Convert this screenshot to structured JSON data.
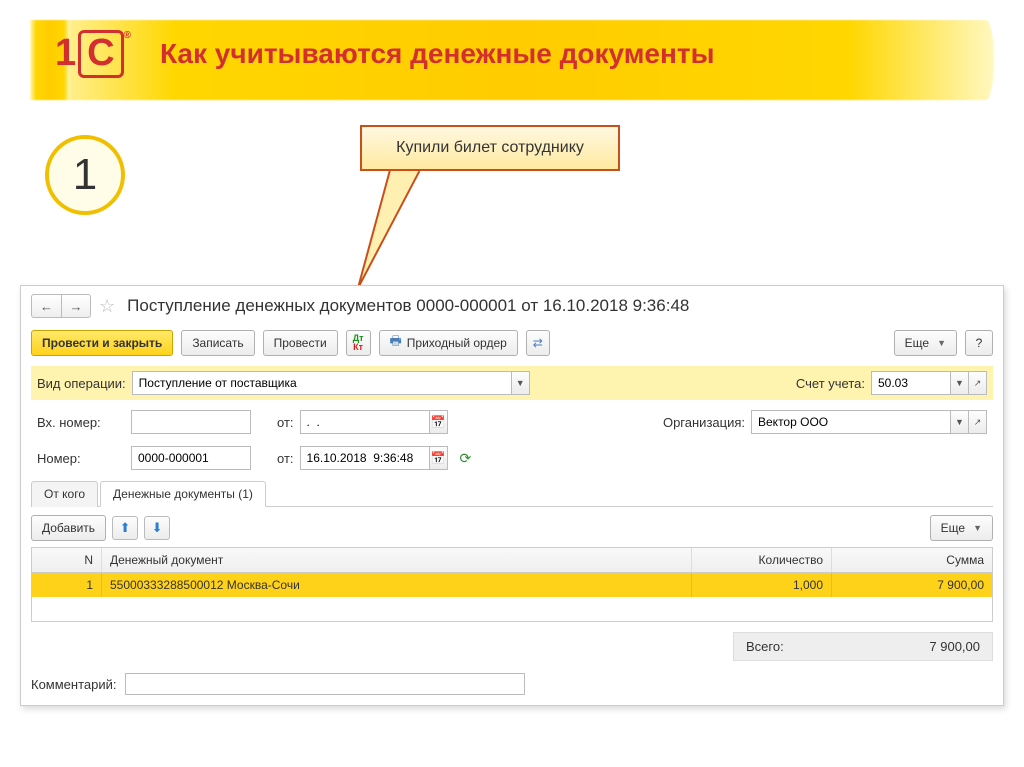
{
  "header": {
    "logo_1": "1",
    "logo_c": "С",
    "title": "Как учитываются денежные документы"
  },
  "step": {
    "number": "1"
  },
  "callout": {
    "text": "Купили билет сотруднику"
  },
  "window": {
    "title": "Поступление денежных документов 0000-000001 от 16.10.2018 9:36:48",
    "toolbar": {
      "post_close": "Провести и закрыть",
      "save": "Записать",
      "post": "Провести",
      "receipt_order": "Приходный ордер",
      "more": "Еще",
      "help": "?"
    },
    "fields": {
      "op_type_label": "Вид операции:",
      "op_type_value": "Поступление от поставщика",
      "account_label": "Счет учета:",
      "account_value": "50.03",
      "in_num_label": "Вх. номер:",
      "in_num_value": "",
      "in_date_label": "от:",
      "in_date_value": ".  .",
      "org_label": "Организация:",
      "org_value": "Вектор ООО",
      "num_label": "Номер:",
      "num_value": "0000-000001",
      "date_label": "от:",
      "date_value": "16.10.2018  9:36:48"
    },
    "tabs": {
      "from": "От кого",
      "docs": "Денежные документы (1)"
    },
    "tab_toolbar": {
      "add": "Добавить",
      "more": "Еще"
    },
    "grid": {
      "col_n": "N",
      "col_doc": "Денежный документ",
      "col_qty": "Количество",
      "col_sum": "Сумма",
      "rows": [
        {
          "n": "1",
          "doc": "55000333288500012 Москва-Сочи",
          "qty": "1,000",
          "sum": "7 900,00"
        }
      ]
    },
    "total": {
      "label": "Всего:",
      "value": "7 900,00"
    },
    "comment_label": "Комментарий:",
    "comment_value": ""
  }
}
